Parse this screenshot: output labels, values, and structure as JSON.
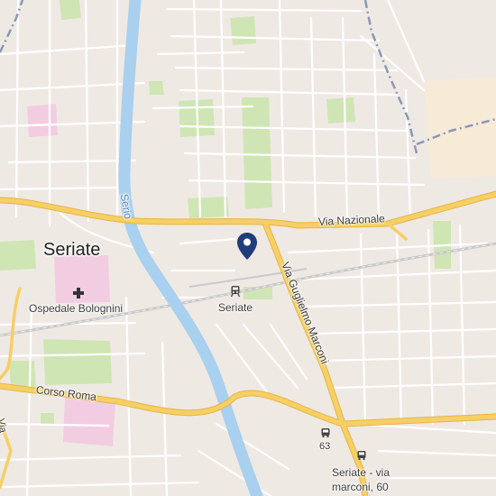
{
  "place_labels": {
    "town": "Seriate",
    "hospital": "Ospedale Bolognini",
    "station": "Seriate",
    "bus_stop": "Seriate - via\nmarconi, 60"
  },
  "road_labels": {
    "via_nazionale": "Via Nazionale",
    "via_marconi": "Via Guglielmo Marconi",
    "corso_roma": "Corso Roma",
    "river": "Serio",
    "left_edge": "Via"
  },
  "route_badge": "63",
  "colors": {
    "land": "#efe9e4",
    "minor_road": "#ffffff",
    "major_road": "#f6cf65",
    "major_road_casing": "#e4b64a",
    "river": "#a9d0ee",
    "park": "#cfe6b4",
    "hospital_area": "#f2cde2",
    "railway": "#cfcfcf",
    "boundary": "#8a98b5",
    "pin": "#1f3d7a"
  },
  "icons": [
    "location-pin-icon",
    "hospital-cross-icon",
    "train-station-icon",
    "bus-stop-icon"
  ]
}
